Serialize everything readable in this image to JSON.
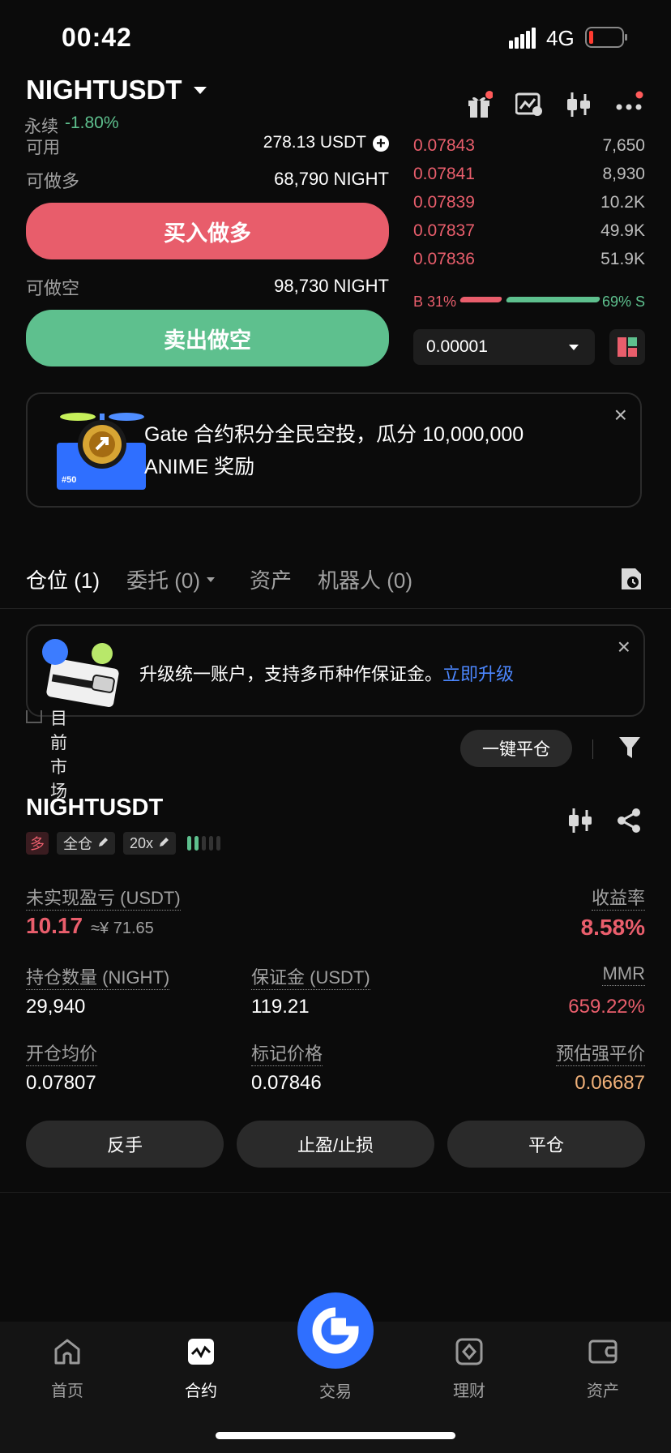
{
  "status_bar": {
    "time": "00:42",
    "network": "4G"
  },
  "header": {
    "symbol": "NIGHTUSDT",
    "contract_type": "永续",
    "change": "-1.80%"
  },
  "order_form": {
    "available_label": "可用",
    "available_value": "278.13 USDT",
    "can_long_label": "可做多",
    "can_long_value": "68,790 NIGHT",
    "buy_long_label": "买入做多",
    "can_short_label": "可做空",
    "can_short_value": "98,730 NIGHT",
    "sell_short_label": "卖出做空"
  },
  "orderbook": {
    "asks": [
      {
        "price": "0.07843",
        "qty": "7,650"
      },
      {
        "price": "0.07841",
        "qty": "8,930"
      },
      {
        "price": "0.07839",
        "qty": "10.2K"
      },
      {
        "price": "0.07837",
        "qty": "49.9K"
      },
      {
        "price": "0.07836",
        "qty": "51.9K"
      }
    ],
    "buy_ratio_label": "B 31%",
    "sell_ratio_label": "69% S",
    "buy_ratio": 0.31,
    "sell_ratio": 0.69,
    "tick_size": "0.00001"
  },
  "promo_banner": {
    "text": "Gate 合约积分全民空投，瓜分 10,000,000 ANIME 奖励",
    "badge": "#50"
  },
  "tabs": [
    {
      "label": "仓位 (1)"
    },
    {
      "label": "委托 (0)"
    },
    {
      "label": "资产"
    },
    {
      "label": "机器人 (0)"
    }
  ],
  "upgrade_banner": {
    "text": "升级统一账户，支持多币种作保证金。",
    "link": "立即升级"
  },
  "filter": {
    "current_market_label": "目前市场",
    "close_all_label": "一键平仓"
  },
  "position": {
    "symbol": "NIGHTUSDT",
    "side": "多",
    "margin_mode": "全仓",
    "leverage": "20x",
    "unrealized_pnl_label": "未实现盈亏 (USDT)",
    "unrealized_pnl": "10.17",
    "unrealized_pnl_cny": "≈¥ 71.65",
    "roe_label": "收益率",
    "roe": "8.58%",
    "size_label": "持仓数量 (NIGHT)",
    "size": "29,940",
    "margin_label": "保证金 (USDT)",
    "margin": "119.21",
    "mmr_label": "MMR",
    "mmr": "659.22%",
    "entry_price_label": "开仓均价",
    "entry_price": "0.07807",
    "mark_price_label": "标记价格",
    "mark_price": "0.07846",
    "liq_price_label": "预估强平价",
    "liq_price": "0.06687",
    "reverse_label": "反手",
    "tpsl_label": "止盈/止损",
    "close_label": "平仓"
  },
  "bottom_nav": [
    {
      "label": "首页",
      "icon": "home-icon"
    },
    {
      "label": "合约",
      "icon": "futures-icon"
    },
    {
      "label": "交易",
      "icon": "gate-logo-icon"
    },
    {
      "label": "理财",
      "icon": "earn-icon"
    },
    {
      "label": "资产",
      "icon": "wallet-icon"
    }
  ],
  "colors": {
    "red": "#e95e6c",
    "green": "#5ec08e",
    "blue": "#2f6fff",
    "bg": "#0b0b0b"
  }
}
